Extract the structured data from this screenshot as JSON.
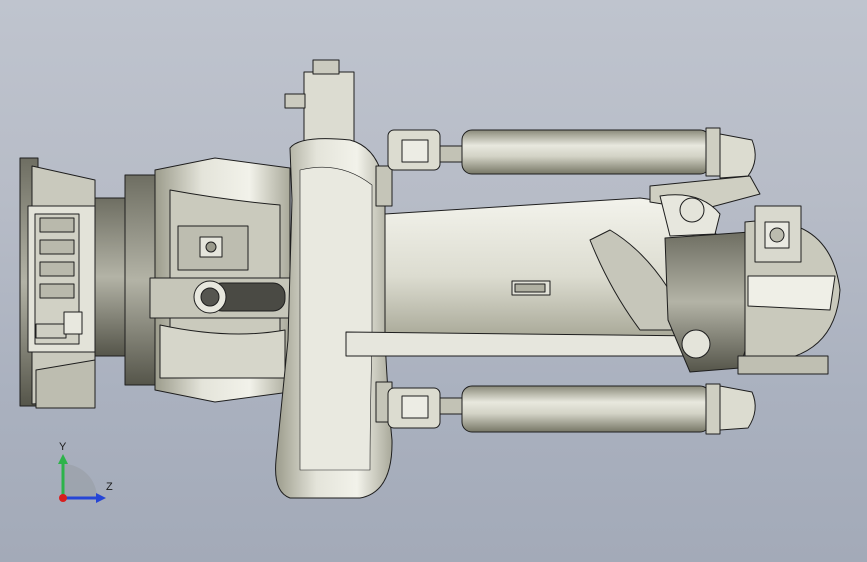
{
  "viewport": {
    "background_top": "#bfc4ce",
    "background_bottom": "#a3aab8"
  },
  "model": {
    "part_color": "#d9d9cf",
    "edge_color": "#1e1e1e"
  },
  "triad": {
    "y_label": "Y",
    "z_label": "Z",
    "y_color": "#2db34a",
    "z_color": "#2545d6",
    "x_color": "#d81e1e"
  }
}
